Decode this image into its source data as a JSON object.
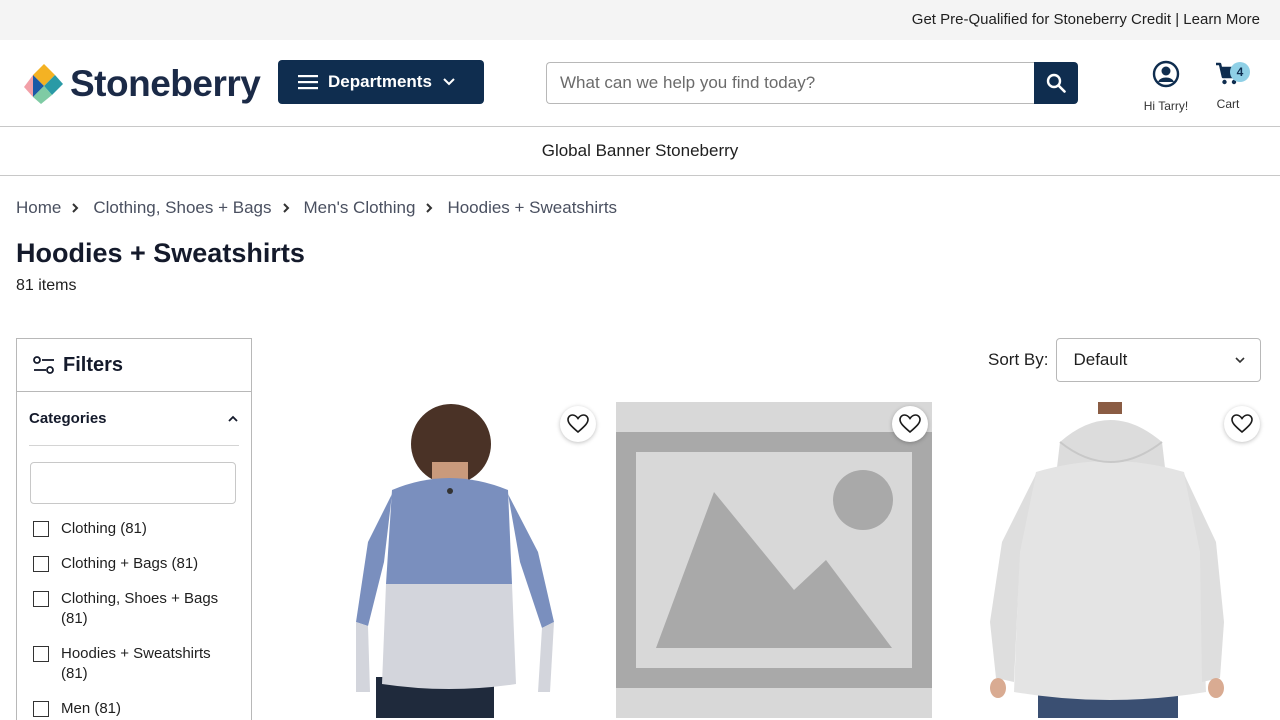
{
  "topbar": {
    "promo_text": "Get Pre-Qualified for Stoneberry Credit | Learn More"
  },
  "header": {
    "logo_text": "Stoneberry",
    "departments_label": "Departments",
    "search_placeholder": "What can we help you find today?",
    "account_label": "Hi Tarry!",
    "cart_label": "Cart",
    "cart_count": "4"
  },
  "global_banner": {
    "text": "Global Banner Stoneberry"
  },
  "breadcrumb": [
    "Home",
    "Clothing, Shoes + Bags",
    "Men's Clothing",
    "Hoodies + Sweatshirts"
  ],
  "page": {
    "title": "Hoodies + Sweatshirts",
    "item_count": "81 items"
  },
  "filters": {
    "title": "Filters",
    "categories_title": "Categories",
    "category_search_value": "",
    "categories": [
      "Clothing (81)",
      "Clothing + Bags (81)",
      "Clothing, Shoes + Bags (81)",
      "Hoodies + Sweatshirts (81)",
      "Men (81)"
    ]
  },
  "sort": {
    "label": "Sort By:",
    "selected": "Default"
  },
  "colors": {
    "navy": "#0f2d4f",
    "badge": "#8fd0e6",
    "placeholder_gray": "#a9a9a9"
  }
}
